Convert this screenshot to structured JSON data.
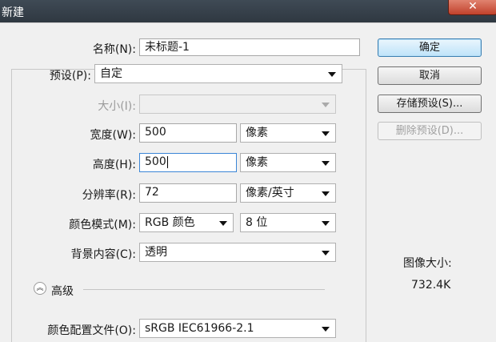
{
  "window": {
    "title": "新建",
    "close_glyph": "✕"
  },
  "form": {
    "name": {
      "label": "名称(N):",
      "value": "未标题-1"
    },
    "preset": {
      "label": "预设(P):",
      "value": "自定"
    },
    "size": {
      "label": "大小(I):",
      "value": ""
    },
    "width": {
      "label": "宽度(W):",
      "value": "500",
      "unit": "像素"
    },
    "height": {
      "label": "高度(H):",
      "value": "500",
      "unit": "像素"
    },
    "resolution": {
      "label": "分辨率(R):",
      "value": "72",
      "unit": "像素/英寸"
    },
    "color_mode": {
      "label": "颜色模式(M):",
      "value": "RGB 颜色",
      "depth": "8 位"
    },
    "background": {
      "label": "背景内容(C):",
      "value": "透明"
    },
    "advanced": {
      "label": "高级",
      "icon": "chevron-up-double-icon"
    },
    "color_profile": {
      "label": "颜色配置文件(O):",
      "value": "sRGB IEC61966-2.1"
    }
  },
  "buttons": {
    "ok": "确定",
    "cancel": "取消",
    "save_preset": "存储预设(S)...",
    "delete_preset": "删除预设(D)..."
  },
  "image_size": {
    "label": "图像大小:",
    "value": "732.4K"
  }
}
